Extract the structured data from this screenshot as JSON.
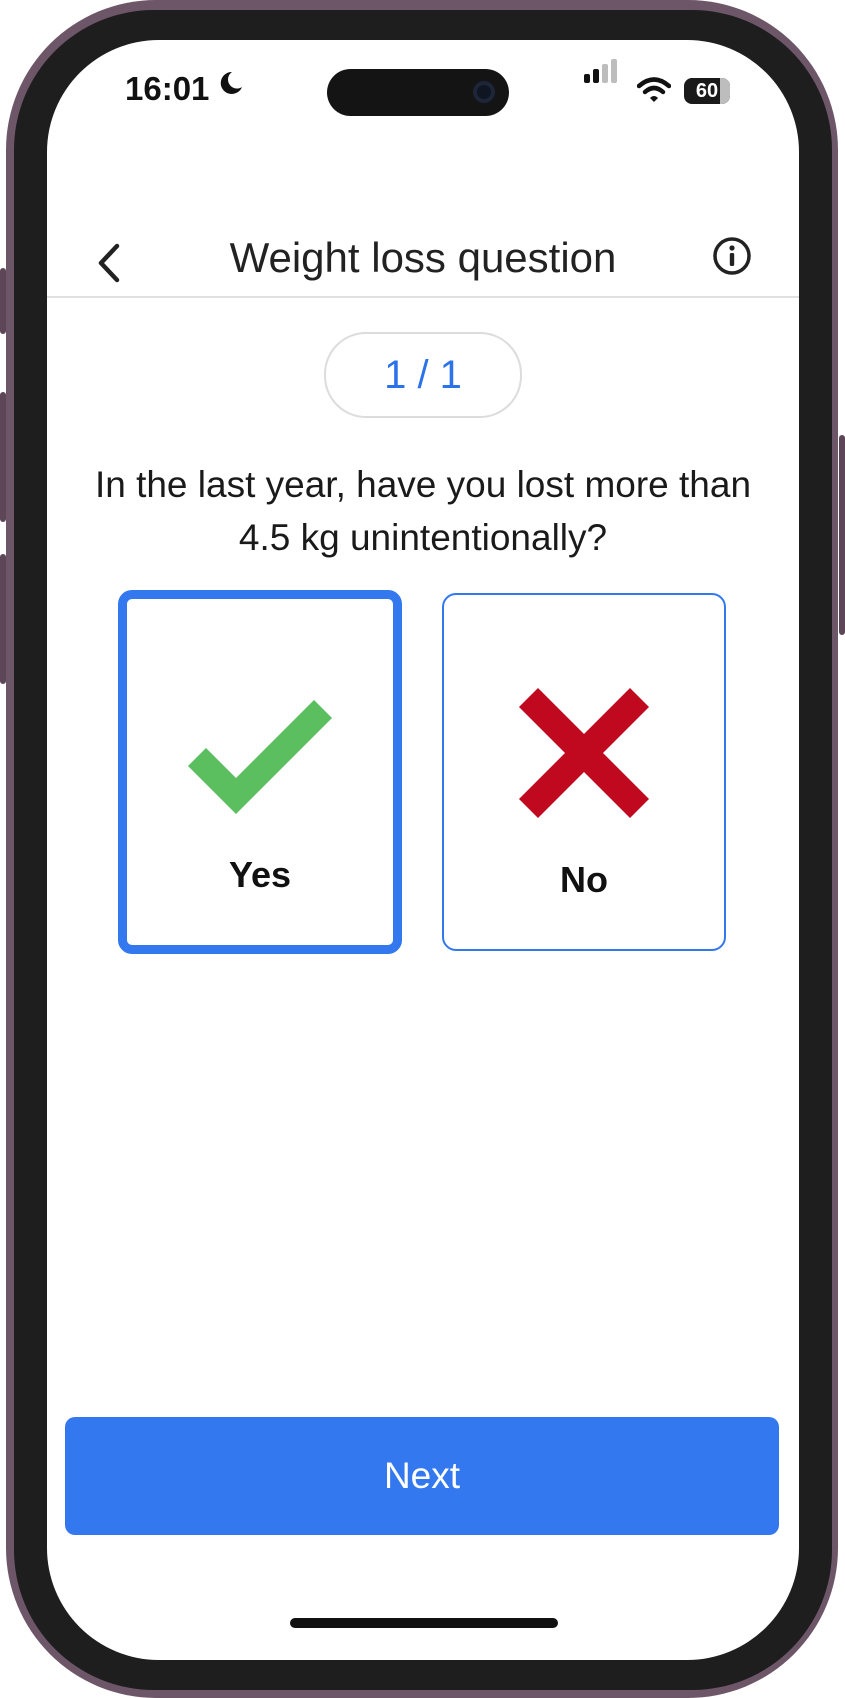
{
  "status_bar": {
    "time": "16:01",
    "battery_level": "60"
  },
  "nav": {
    "title": "Weight loss question",
    "back_icon": "chevron-left-icon",
    "info_icon": "info-circle-icon"
  },
  "progress": {
    "label": "1 / 1"
  },
  "question": {
    "text": "In the last year, have you lost more than 4.5 kg unintentionally?"
  },
  "options": [
    {
      "label": "Yes",
      "icon": "checkmark-icon",
      "selected": true,
      "icon_color": "#5bbf5f"
    },
    {
      "label": "No",
      "icon": "cross-icon",
      "selected": false,
      "icon_color": "#c0091f"
    }
  ],
  "footer": {
    "next_label": "Next"
  },
  "colors": {
    "accent": "#3478f0"
  }
}
